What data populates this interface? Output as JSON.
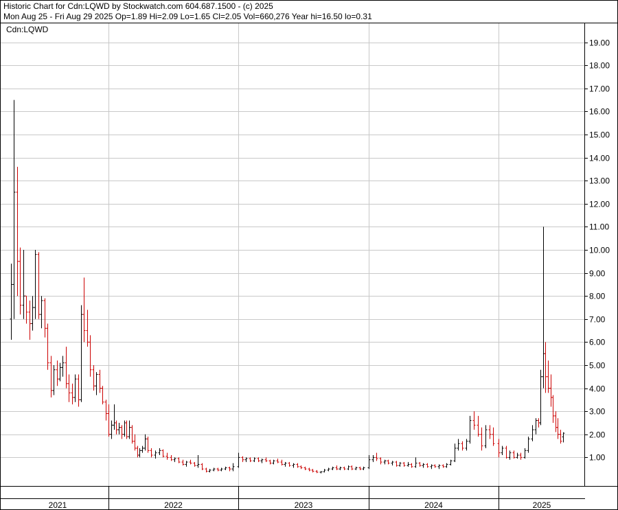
{
  "header": {
    "line1": "Historic Chart for Cdn:LQWD by Stockwatch.com 604.687.1500 - (c) 2025",
    "line2": "Mon Aug 25 - Fri Aug 29 2025   Op=1.89   Hi=2.09   Lo=1.65   Cl=2.05   Vol=660,276   Year hi=16.50   lo=0.31"
  },
  "colors": {
    "up": "#000000",
    "down": "#cc0000",
    "grid": "#c8c8c8",
    "frame": "#000000"
  },
  "chart_data": {
    "type": "ohlc",
    "symbol_label": "Cdn:LQWD",
    "y_ticks": [
      "1.00",
      "2.00",
      "3.00",
      "4.00",
      "5.00",
      "6.00",
      "7.00",
      "8.00",
      "9.00",
      "10.00",
      "11.00",
      "12.00",
      "13.00",
      "14.00",
      "15.00",
      "16.00",
      "17.00",
      "18.00",
      "19.00"
    ],
    "ylim": [
      0.31,
      20
    ],
    "x_years": [
      "2021",
      "2022",
      "2023",
      "2024",
      "2025"
    ],
    "year_breaks": [
      2021.5,
      2022,
      2023,
      2024,
      2025,
      2025.7
    ],
    "grid": true,
    "bars": [
      {
        "t": 2021.52,
        "o": 7.0,
        "h": 9.4,
        "l": 6.1,
        "c": 8.5
      },
      {
        "t": 2021.535,
        "o": 8.5,
        "h": 16.5,
        "l": 7.0,
        "c": 12.5
      },
      {
        "t": 2021.55,
        "o": 12.5,
        "h": 13.6,
        "l": 8.0,
        "c": 9.5
      },
      {
        "t": 2021.565,
        "o": 9.5,
        "h": 10.1,
        "l": 7.2,
        "c": 7.6
      },
      {
        "t": 2021.58,
        "o": 7.6,
        "h": 10.0,
        "l": 7.0,
        "c": 8.0
      },
      {
        "t": 2021.595,
        "o": 8.0,
        "h": 8.0,
        "l": 6.8,
        "c": 7.3
      },
      {
        "t": 2021.61,
        "o": 7.3,
        "h": 7.8,
        "l": 6.1,
        "c": 6.8
      },
      {
        "t": 2021.625,
        "o": 6.8,
        "h": 8.0,
        "l": 6.5,
        "c": 7.5
      },
      {
        "t": 2021.64,
        "o": 7.5,
        "h": 10.0,
        "l": 7.0,
        "c": 9.8
      },
      {
        "t": 2021.655,
        "o": 9.8,
        "h": 9.9,
        "l": 7.0,
        "c": 7.2
      },
      {
        "t": 2021.67,
        "o": 7.2,
        "h": 8.0,
        "l": 6.6,
        "c": 7.8
      },
      {
        "t": 2021.685,
        "o": 7.8,
        "h": 7.9,
        "l": 6.2,
        "c": 6.6
      },
      {
        "t": 2021.7,
        "o": 6.6,
        "h": 6.8,
        "l": 4.8,
        "c": 5.1
      },
      {
        "t": 2021.715,
        "o": 5.1,
        "h": 5.4,
        "l": 3.6,
        "c": 3.9
      },
      {
        "t": 2021.73,
        "o": 3.9,
        "h": 5.0,
        "l": 3.7,
        "c": 4.8
      },
      {
        "t": 2021.745,
        "o": 4.8,
        "h": 5.2,
        "l": 4.1,
        "c": 4.4
      },
      {
        "t": 2021.76,
        "o": 4.4,
        "h": 5.1,
        "l": 4.3,
        "c": 4.9
      },
      {
        "t": 2021.775,
        "o": 4.9,
        "h": 5.4,
        "l": 4.5,
        "c": 5.1
      },
      {
        "t": 2021.79,
        "o": 5.1,
        "h": 5.8,
        "l": 4.0,
        "c": 4.2
      },
      {
        "t": 2021.805,
        "o": 4.2,
        "h": 4.6,
        "l": 3.4,
        "c": 3.8
      },
      {
        "t": 2021.82,
        "o": 3.8,
        "h": 4.2,
        "l": 3.3,
        "c": 3.6
      },
      {
        "t": 2021.835,
        "o": 3.6,
        "h": 4.6,
        "l": 3.4,
        "c": 4.4
      },
      {
        "t": 2021.85,
        "o": 4.4,
        "h": 4.6,
        "l": 3.2,
        "c": 3.5
      },
      {
        "t": 2021.865,
        "o": 3.5,
        "h": 7.6,
        "l": 3.4,
        "c": 7.2
      },
      {
        "t": 2021.88,
        "o": 7.2,
        "h": 8.8,
        "l": 6.0,
        "c": 6.5
      },
      {
        "t": 2021.895,
        "o": 6.5,
        "h": 7.4,
        "l": 5.8,
        "c": 6.0
      },
      {
        "t": 2021.91,
        "o": 6.0,
        "h": 6.3,
        "l": 4.5,
        "c": 4.8
      },
      {
        "t": 2021.925,
        "o": 4.8,
        "h": 5.0,
        "l": 3.9,
        "c": 4.1
      },
      {
        "t": 2021.94,
        "o": 4.1,
        "h": 4.7,
        "l": 3.7,
        "c": 4.6
      },
      {
        "t": 2021.955,
        "o": 4.6,
        "h": 4.8,
        "l": 3.8,
        "c": 4.0
      },
      {
        "t": 2021.97,
        "o": 4.0,
        "h": 4.1,
        "l": 3.3,
        "c": 3.4
      },
      {
        "t": 2021.985,
        "o": 3.4,
        "h": 3.5,
        "l": 2.6,
        "c": 2.9
      },
      {
        "t": 2022.0,
        "o": 2.9,
        "h": 3.3,
        "l": 1.9,
        "c": 2.0
      },
      {
        "t": 2022.02,
        "o": 2.0,
        "h": 2.6,
        "l": 1.8,
        "c": 2.4
      },
      {
        "t": 2022.04,
        "o": 2.4,
        "h": 3.3,
        "l": 2.2,
        "c": 2.5
      },
      {
        "t": 2022.06,
        "o": 2.5,
        "h": 2.6,
        "l": 2.0,
        "c": 2.2
      },
      {
        "t": 2022.08,
        "o": 2.2,
        "h": 2.5,
        "l": 2.0,
        "c": 2.3
      },
      {
        "t": 2022.1,
        "o": 2.3,
        "h": 2.4,
        "l": 1.8,
        "c": 2.0
      },
      {
        "t": 2022.12,
        "o": 2.0,
        "h": 2.6,
        "l": 1.9,
        "c": 2.5
      },
      {
        "t": 2022.14,
        "o": 2.5,
        "h": 2.6,
        "l": 1.8,
        "c": 1.9
      },
      {
        "t": 2022.16,
        "o": 1.9,
        "h": 2.6,
        "l": 1.8,
        "c": 2.3
      },
      {
        "t": 2022.18,
        "o": 2.3,
        "h": 2.4,
        "l": 1.6,
        "c": 1.7
      },
      {
        "t": 2022.2,
        "o": 1.7,
        "h": 2.0,
        "l": 1.3,
        "c": 1.4
      },
      {
        "t": 2022.22,
        "o": 1.4,
        "h": 1.5,
        "l": 1.0,
        "c": 1.1
      },
      {
        "t": 2022.24,
        "o": 1.1,
        "h": 1.4,
        "l": 1.0,
        "c": 1.3
      },
      {
        "t": 2022.26,
        "o": 1.3,
        "h": 1.5,
        "l": 1.2,
        "c": 1.4
      },
      {
        "t": 2022.28,
        "o": 1.4,
        "h": 2.0,
        "l": 1.3,
        "c": 1.8
      },
      {
        "t": 2022.3,
        "o": 1.8,
        "h": 1.9,
        "l": 1.2,
        "c": 1.3
      },
      {
        "t": 2022.33,
        "o": 1.3,
        "h": 1.4,
        "l": 1.0,
        "c": 1.1
      },
      {
        "t": 2022.36,
        "o": 1.1,
        "h": 1.3,
        "l": 0.95,
        "c": 1.2
      },
      {
        "t": 2022.39,
        "o": 1.2,
        "h": 1.4,
        "l": 1.1,
        "c": 1.3
      },
      {
        "t": 2022.42,
        "o": 1.3,
        "h": 1.35,
        "l": 1.0,
        "c": 1.05
      },
      {
        "t": 2022.45,
        "o": 1.05,
        "h": 1.2,
        "l": 0.9,
        "c": 1.0
      },
      {
        "t": 2022.48,
        "o": 1.0,
        "h": 1.1,
        "l": 0.85,
        "c": 0.9
      },
      {
        "t": 2022.51,
        "o": 0.9,
        "h": 1.0,
        "l": 0.8,
        "c": 0.95
      },
      {
        "t": 2022.54,
        "o": 0.95,
        "h": 1.0,
        "l": 0.75,
        "c": 0.8
      },
      {
        "t": 2022.57,
        "o": 0.8,
        "h": 0.9,
        "l": 0.65,
        "c": 0.7
      },
      {
        "t": 2022.6,
        "o": 0.7,
        "h": 0.85,
        "l": 0.6,
        "c": 0.8
      },
      {
        "t": 2022.63,
        "o": 0.8,
        "h": 0.9,
        "l": 0.7,
        "c": 0.75
      },
      {
        "t": 2022.66,
        "o": 0.75,
        "h": 0.8,
        "l": 0.6,
        "c": 0.65
      },
      {
        "t": 2022.69,
        "o": 0.65,
        "h": 1.1,
        "l": 0.55,
        "c": 0.7
      },
      {
        "t": 2022.72,
        "o": 0.7,
        "h": 0.75,
        "l": 0.45,
        "c": 0.5
      },
      {
        "t": 2022.75,
        "o": 0.5,
        "h": 0.55,
        "l": 0.35,
        "c": 0.4
      },
      {
        "t": 2022.78,
        "o": 0.4,
        "h": 0.5,
        "l": 0.35,
        "c": 0.45
      },
      {
        "t": 2022.81,
        "o": 0.45,
        "h": 0.55,
        "l": 0.4,
        "c": 0.5
      },
      {
        "t": 2022.84,
        "o": 0.5,
        "h": 0.55,
        "l": 0.4,
        "c": 0.45
      },
      {
        "t": 2022.87,
        "o": 0.45,
        "h": 0.55,
        "l": 0.4,
        "c": 0.5
      },
      {
        "t": 2022.9,
        "o": 0.5,
        "h": 0.6,
        "l": 0.45,
        "c": 0.55
      },
      {
        "t": 2022.93,
        "o": 0.55,
        "h": 0.6,
        "l": 0.4,
        "c": 0.5
      },
      {
        "t": 2022.96,
        "o": 0.5,
        "h": 0.75,
        "l": 0.4,
        "c": 0.6
      },
      {
        "t": 2023.0,
        "o": 0.6,
        "h": 1.2,
        "l": 0.55,
        "c": 1.0
      },
      {
        "t": 2023.03,
        "o": 1.0,
        "h": 1.05,
        "l": 0.8,
        "c": 0.9
      },
      {
        "t": 2023.06,
        "o": 0.9,
        "h": 1.0,
        "l": 0.8,
        "c": 0.95
      },
      {
        "t": 2023.09,
        "o": 0.95,
        "h": 1.0,
        "l": 0.8,
        "c": 0.85
      },
      {
        "t": 2023.12,
        "o": 0.85,
        "h": 1.0,
        "l": 0.8,
        "c": 0.95
      },
      {
        "t": 2023.15,
        "o": 0.95,
        "h": 1.0,
        "l": 0.8,
        "c": 0.85
      },
      {
        "t": 2023.18,
        "o": 0.85,
        "h": 0.95,
        "l": 0.75,
        "c": 0.9
      },
      {
        "t": 2023.21,
        "o": 0.9,
        "h": 1.0,
        "l": 0.8,
        "c": 0.85
      },
      {
        "t": 2023.24,
        "o": 0.85,
        "h": 0.9,
        "l": 0.7,
        "c": 0.75
      },
      {
        "t": 2023.27,
        "o": 0.75,
        "h": 0.9,
        "l": 0.7,
        "c": 0.85
      },
      {
        "t": 2023.3,
        "o": 0.85,
        "h": 0.95,
        "l": 0.75,
        "c": 0.8
      },
      {
        "t": 2023.33,
        "o": 0.8,
        "h": 0.9,
        "l": 0.65,
        "c": 0.7
      },
      {
        "t": 2023.36,
        "o": 0.7,
        "h": 0.8,
        "l": 0.6,
        "c": 0.75
      },
      {
        "t": 2023.39,
        "o": 0.75,
        "h": 0.8,
        "l": 0.6,
        "c": 0.65
      },
      {
        "t": 2023.42,
        "o": 0.65,
        "h": 0.75,
        "l": 0.55,
        "c": 0.7
      },
      {
        "t": 2023.45,
        "o": 0.7,
        "h": 0.75,
        "l": 0.55,
        "c": 0.6
      },
      {
        "t": 2023.48,
        "o": 0.6,
        "h": 0.65,
        "l": 0.5,
        "c": 0.55
      },
      {
        "t": 2023.51,
        "o": 0.55,
        "h": 0.6,
        "l": 0.45,
        "c": 0.5
      },
      {
        "t": 2023.54,
        "o": 0.5,
        "h": 0.55,
        "l": 0.4,
        "c": 0.45
      },
      {
        "t": 2023.57,
        "o": 0.45,
        "h": 0.5,
        "l": 0.35,
        "c": 0.4
      },
      {
        "t": 2023.6,
        "o": 0.4,
        "h": 0.45,
        "l": 0.32,
        "c": 0.36
      },
      {
        "t": 2023.63,
        "o": 0.36,
        "h": 0.4,
        "l": 0.31,
        "c": 0.38
      },
      {
        "t": 2023.66,
        "o": 0.38,
        "h": 0.5,
        "l": 0.35,
        "c": 0.45
      },
      {
        "t": 2023.69,
        "o": 0.45,
        "h": 0.55,
        "l": 0.4,
        "c": 0.5
      },
      {
        "t": 2023.72,
        "o": 0.5,
        "h": 0.6,
        "l": 0.45,
        "c": 0.55
      },
      {
        "t": 2023.75,
        "o": 0.55,
        "h": 0.65,
        "l": 0.45,
        "c": 0.5
      },
      {
        "t": 2023.78,
        "o": 0.5,
        "h": 0.6,
        "l": 0.45,
        "c": 0.55
      },
      {
        "t": 2023.81,
        "o": 0.55,
        "h": 0.6,
        "l": 0.45,
        "c": 0.5
      },
      {
        "t": 2023.84,
        "o": 0.5,
        "h": 0.65,
        "l": 0.45,
        "c": 0.6
      },
      {
        "t": 2023.87,
        "o": 0.6,
        "h": 0.65,
        "l": 0.45,
        "c": 0.5
      },
      {
        "t": 2023.9,
        "o": 0.5,
        "h": 0.6,
        "l": 0.45,
        "c": 0.55
      },
      {
        "t": 2023.93,
        "o": 0.55,
        "h": 0.6,
        "l": 0.45,
        "c": 0.5
      },
      {
        "t": 2023.96,
        "o": 0.5,
        "h": 0.6,
        "l": 0.45,
        "c": 0.55
      },
      {
        "t": 2024.0,
        "o": 0.55,
        "h": 1.1,
        "l": 0.5,
        "c": 0.9
      },
      {
        "t": 2024.03,
        "o": 0.9,
        "h": 1.1,
        "l": 0.8,
        "c": 1.0
      },
      {
        "t": 2024.06,
        "o": 1.0,
        "h": 1.2,
        "l": 0.85,
        "c": 0.95
      },
      {
        "t": 2024.09,
        "o": 0.95,
        "h": 1.0,
        "l": 0.7,
        "c": 0.8
      },
      {
        "t": 2024.12,
        "o": 0.8,
        "h": 0.9,
        "l": 0.7,
        "c": 0.85
      },
      {
        "t": 2024.15,
        "o": 0.85,
        "h": 0.9,
        "l": 0.7,
        "c": 0.75
      },
      {
        "t": 2024.18,
        "o": 0.75,
        "h": 0.85,
        "l": 0.65,
        "c": 0.8
      },
      {
        "t": 2024.21,
        "o": 0.8,
        "h": 0.85,
        "l": 0.6,
        "c": 0.65
      },
      {
        "t": 2024.24,
        "o": 0.65,
        "h": 0.8,
        "l": 0.6,
        "c": 0.75
      },
      {
        "t": 2024.27,
        "o": 0.75,
        "h": 0.8,
        "l": 0.6,
        "c": 0.65
      },
      {
        "t": 2024.3,
        "o": 0.65,
        "h": 0.8,
        "l": 0.6,
        "c": 0.7
      },
      {
        "t": 2024.33,
        "o": 0.7,
        "h": 0.75,
        "l": 0.55,
        "c": 0.6
      },
      {
        "t": 2024.36,
        "o": 0.6,
        "h": 1.0,
        "l": 0.55,
        "c": 0.75
      },
      {
        "t": 2024.39,
        "o": 0.75,
        "h": 0.8,
        "l": 0.6,
        "c": 0.65
      },
      {
        "t": 2024.42,
        "o": 0.65,
        "h": 0.75,
        "l": 0.55,
        "c": 0.7
      },
      {
        "t": 2024.45,
        "o": 0.7,
        "h": 0.75,
        "l": 0.55,
        "c": 0.6
      },
      {
        "t": 2024.48,
        "o": 0.6,
        "h": 0.7,
        "l": 0.5,
        "c": 0.65
      },
      {
        "t": 2024.51,
        "o": 0.65,
        "h": 0.7,
        "l": 0.55,
        "c": 0.6
      },
      {
        "t": 2024.54,
        "o": 0.6,
        "h": 0.7,
        "l": 0.5,
        "c": 0.65
      },
      {
        "t": 2024.57,
        "o": 0.65,
        "h": 0.7,
        "l": 0.55,
        "c": 0.6
      },
      {
        "t": 2024.6,
        "o": 0.6,
        "h": 0.75,
        "l": 0.55,
        "c": 0.7
      },
      {
        "t": 2024.63,
        "o": 0.7,
        "h": 0.9,
        "l": 0.65,
        "c": 0.85
      },
      {
        "t": 2024.66,
        "o": 0.85,
        "h": 1.6,
        "l": 0.8,
        "c": 1.4
      },
      {
        "t": 2024.69,
        "o": 1.4,
        "h": 1.8,
        "l": 1.3,
        "c": 1.6
      },
      {
        "t": 2024.72,
        "o": 1.6,
        "h": 1.7,
        "l": 1.3,
        "c": 1.4
      },
      {
        "t": 2024.75,
        "o": 1.4,
        "h": 1.8,
        "l": 1.3,
        "c": 1.7
      },
      {
        "t": 2024.78,
        "o": 1.7,
        "h": 2.8,
        "l": 1.6,
        "c": 2.6
      },
      {
        "t": 2024.81,
        "o": 2.6,
        "h": 3.0,
        "l": 2.2,
        "c": 2.4
      },
      {
        "t": 2024.84,
        "o": 2.4,
        "h": 2.8,
        "l": 1.9,
        "c": 2.0
      },
      {
        "t": 2024.87,
        "o": 2.0,
        "h": 2.3,
        "l": 1.3,
        "c": 1.5
      },
      {
        "t": 2024.9,
        "o": 1.5,
        "h": 2.4,
        "l": 1.4,
        "c": 2.2
      },
      {
        "t": 2024.93,
        "o": 2.2,
        "h": 2.4,
        "l": 1.8,
        "c": 2.0
      },
      {
        "t": 2024.96,
        "o": 2.0,
        "h": 2.3,
        "l": 1.5,
        "c": 1.6
      },
      {
        "t": 2025.0,
        "o": 1.6,
        "h": 1.8,
        "l": 1.0,
        "c": 1.2
      },
      {
        "t": 2025.03,
        "o": 1.2,
        "h": 1.5,
        "l": 1.1,
        "c": 1.4
      },
      {
        "t": 2025.06,
        "o": 1.4,
        "h": 1.5,
        "l": 0.95,
        "c": 1.0
      },
      {
        "t": 2025.09,
        "o": 1.0,
        "h": 1.3,
        "l": 0.9,
        "c": 1.2
      },
      {
        "t": 2025.12,
        "o": 1.2,
        "h": 1.3,
        "l": 0.95,
        "c": 1.0
      },
      {
        "t": 2025.15,
        "o": 1.0,
        "h": 1.2,
        "l": 0.95,
        "c": 1.1
      },
      {
        "t": 2025.18,
        "o": 1.1,
        "h": 1.2,
        "l": 0.9,
        "c": 1.0
      },
      {
        "t": 2025.21,
        "o": 1.0,
        "h": 1.4,
        "l": 0.95,
        "c": 1.3
      },
      {
        "t": 2025.24,
        "o": 1.3,
        "h": 1.9,
        "l": 1.2,
        "c": 1.8
      },
      {
        "t": 2025.27,
        "o": 1.8,
        "h": 2.4,
        "l": 1.7,
        "c": 2.2
      },
      {
        "t": 2025.3,
        "o": 2.2,
        "h": 2.7,
        "l": 2.0,
        "c": 2.6
      },
      {
        "t": 2025.32,
        "o": 2.6,
        "h": 2.7,
        "l": 2.3,
        "c": 2.5
      },
      {
        "t": 2025.34,
        "o": 2.5,
        "h": 4.8,
        "l": 2.4,
        "c": 4.5
      },
      {
        "t": 2025.36,
        "o": 4.5,
        "h": 11.0,
        "l": 4.0,
        "c": 5.5
      },
      {
        "t": 2025.38,
        "o": 5.5,
        "h": 6.0,
        "l": 3.8,
        "c": 4.5
      },
      {
        "t": 2025.4,
        "o": 4.5,
        "h": 5.2,
        "l": 3.8,
        "c": 4.0
      },
      {
        "t": 2025.42,
        "o": 4.0,
        "h": 4.6,
        "l": 3.2,
        "c": 3.6
      },
      {
        "t": 2025.44,
        "o": 3.6,
        "h": 3.7,
        "l": 2.5,
        "c": 2.8
      },
      {
        "t": 2025.46,
        "o": 2.8,
        "h": 3.0,
        "l": 2.1,
        "c": 2.3
      },
      {
        "t": 2025.48,
        "o": 2.3,
        "h": 2.7,
        "l": 1.8,
        "c": 2.0
      },
      {
        "t": 2025.5,
        "o": 2.0,
        "h": 2.2,
        "l": 1.6,
        "c": 1.7
      },
      {
        "t": 2025.52,
        "o": 1.89,
        "h": 2.09,
        "l": 1.65,
        "c": 2.05
      }
    ]
  }
}
